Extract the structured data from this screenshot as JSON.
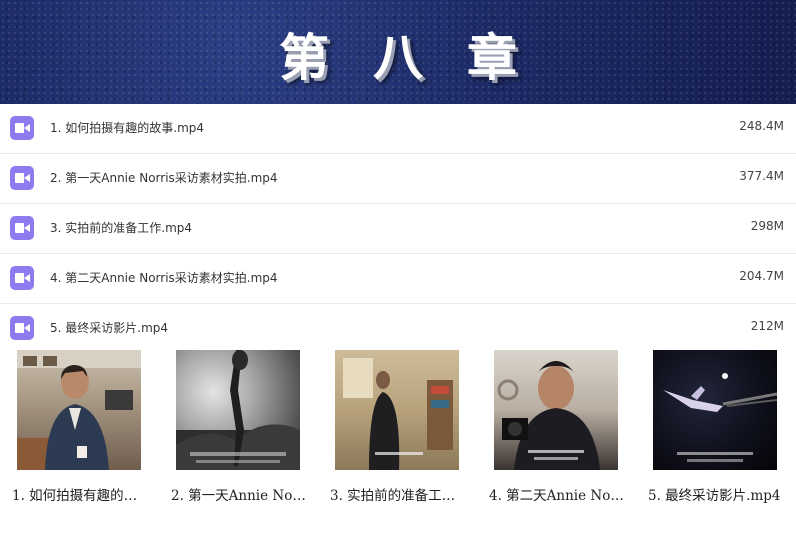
{
  "banner": {
    "title": "第八章"
  },
  "files": [
    {
      "name": "1. 如何拍摄有趣的故事.mp4",
      "size": "248.4M"
    },
    {
      "name": "2. 第一天Annie Norris采访素材实拍.mp4",
      "size": "377.4M"
    },
    {
      "name": "3. 实拍前的准备工作.mp4",
      "size": "298M"
    },
    {
      "name": "4. 第二天Annie Norris采访素材实拍.mp4",
      "size": "204.7M"
    },
    {
      "name": "5. 最终采访影片.mp4",
      "size": "212M"
    }
  ],
  "thumbnails": [
    {
      "caption": "1. 如何拍摄有趣的…"
    },
    {
      "caption": "2. 第一天Annie No…"
    },
    {
      "caption": "3. 实拍前的准备工…"
    },
    {
      "caption": "4. 第二天Annie No…"
    },
    {
      "caption": "5. 最终采访影片.mp4"
    }
  ],
  "icons": {
    "file": "video-file-icon"
  },
  "colors": {
    "banner": "#1c2a66",
    "icon": "#8c7cf0"
  }
}
